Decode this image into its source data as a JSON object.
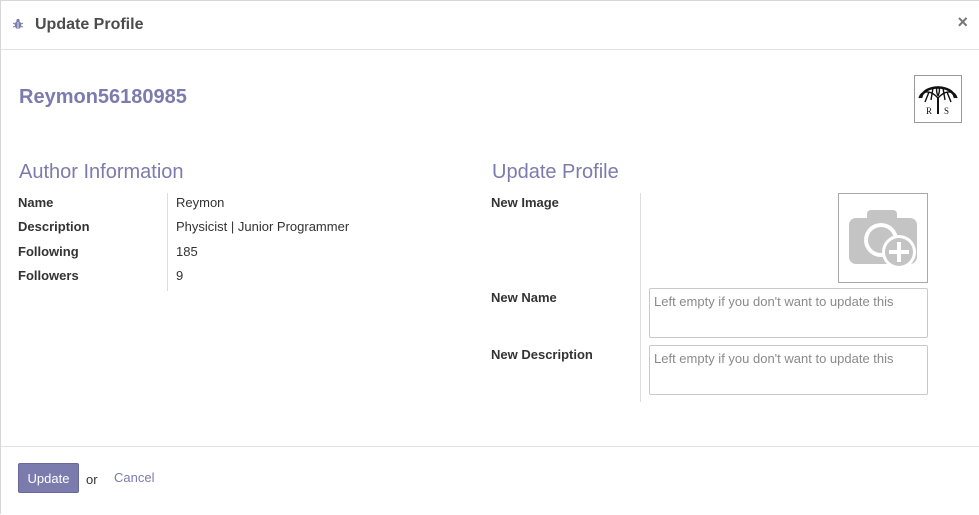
{
  "dialog": {
    "title": "Update Profile",
    "close_label": "×"
  },
  "record": {
    "name": "Reymon56180985",
    "avatar_initials": "R   S"
  },
  "author_info": {
    "title": "Author Information",
    "fields": [
      {
        "label": "Name",
        "value": "Reymon"
      },
      {
        "label": "Description",
        "value": "Physicist | Junior Programmer"
      },
      {
        "label": "Following",
        "value": "185"
      },
      {
        "label": "Followers",
        "value": "9"
      }
    ]
  },
  "update_profile": {
    "title": "Update Profile",
    "new_image_label": "New Image",
    "new_name_label": "New Name",
    "new_name_placeholder": "Left empty if you don't want to update this",
    "new_description_label": "New Description",
    "new_description_placeholder": "Left empty if you don't want to update this"
  },
  "footer": {
    "update_label": "Update",
    "or_text": "or",
    "cancel_label": "Cancel"
  },
  "colors": {
    "accent": "#7c7bad",
    "placeholder_icon": "#c4c4c4"
  },
  "icons": [
    "bug-icon",
    "close-icon",
    "camera-add-icon"
  ]
}
